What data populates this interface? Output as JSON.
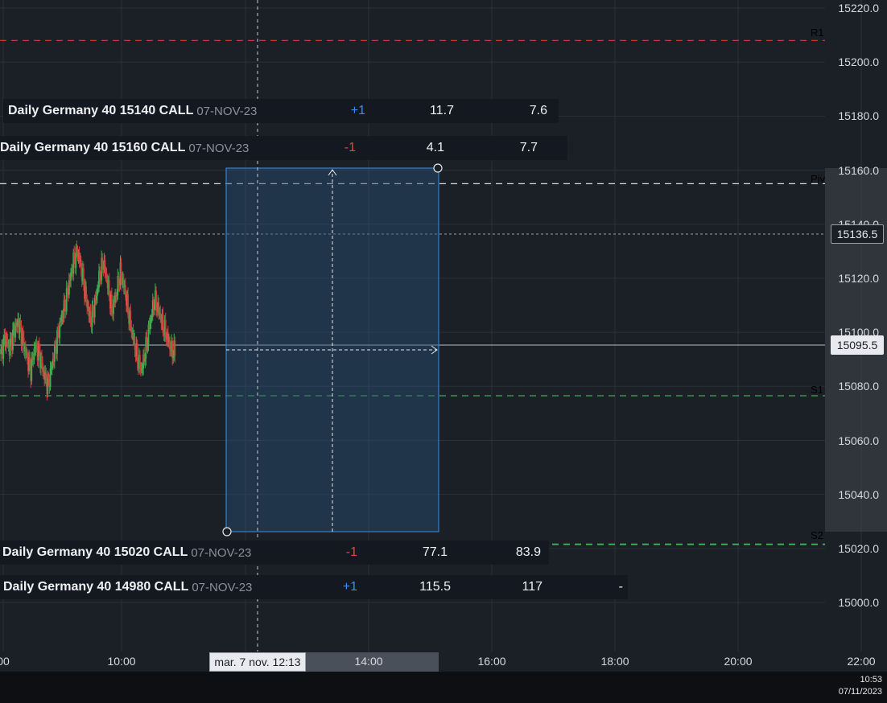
{
  "price_axis": {
    "ticks": [
      "15220.0",
      "15200.0",
      "15180.0",
      "15160.0",
      "15140.0",
      "15120.0",
      "15100.0",
      "15080.0",
      "15060.0",
      "15040.0",
      "15020.0",
      "15000.0"
    ],
    "crosshair_price": "15136.5",
    "last_price": "15095.5"
  },
  "time_axis": {
    "ticks": [
      "00",
      "10:00",
      "14:00",
      "16:00",
      "18:00",
      "20:00",
      "22:00"
    ],
    "crosshair_time": "mar. 7 nov. 12:13"
  },
  "levels": {
    "r1": {
      "label": "R1",
      "price": 15208,
      "color": "#d63c3c"
    },
    "pivot": {
      "label": "Piv",
      "price": 15155,
      "color": "#d9dce1"
    },
    "s1": {
      "label": "S1",
      "price": 15076.5,
      "color": "#3fae4f"
    },
    "s2": {
      "label": "S2",
      "price": 15021.5,
      "color": "#3fae4f"
    }
  },
  "options": [
    {
      "name": "Daily Germany 40 15140 CALL",
      "date": "07-NOV-23",
      "qty": "+1",
      "bid": "11.7",
      "ask": "7.6",
      "extra": ""
    },
    {
      "name": "Daily Germany 40 15160 CALL",
      "date": "07-NOV-23",
      "qty": "-1",
      "bid": "4.1",
      "ask": "7.7",
      "extra": ""
    },
    {
      "name": "Daily Germany 40 15020 CALL",
      "date": "07-NOV-23",
      "qty": "-1",
      "bid": "77.1",
      "ask": "83.9",
      "extra": ""
    },
    {
      "name": "Daily Germany 40 14980 CALL",
      "date": "07-NOV-23",
      "qty": "+1",
      "bid": "115.5",
      "ask": "117",
      "extra": "-"
    }
  ],
  "clock": {
    "time": "10:53",
    "date": "07/11/2023"
  },
  "colors": {
    "background": "#1b1f26",
    "candle_up": "#3fae4f",
    "candle_down": "#d63c3c",
    "range_box": "#3a7fc4"
  },
  "chart_data": {
    "type": "candlestick",
    "xlabel": "",
    "ylabel": "",
    "ylim": [
      14985,
      15225
    ],
    "x": [
      "08:00",
      "08:30",
      "09:00",
      "09:30",
      "10:00",
      "10:30",
      "11:00"
    ],
    "series": [
      {
        "values": [
          15100,
          15090,
          15082,
          15110,
          15130,
          15120,
          15108,
          15122,
          15105,
          15096
        ]
      }
    ]
  }
}
